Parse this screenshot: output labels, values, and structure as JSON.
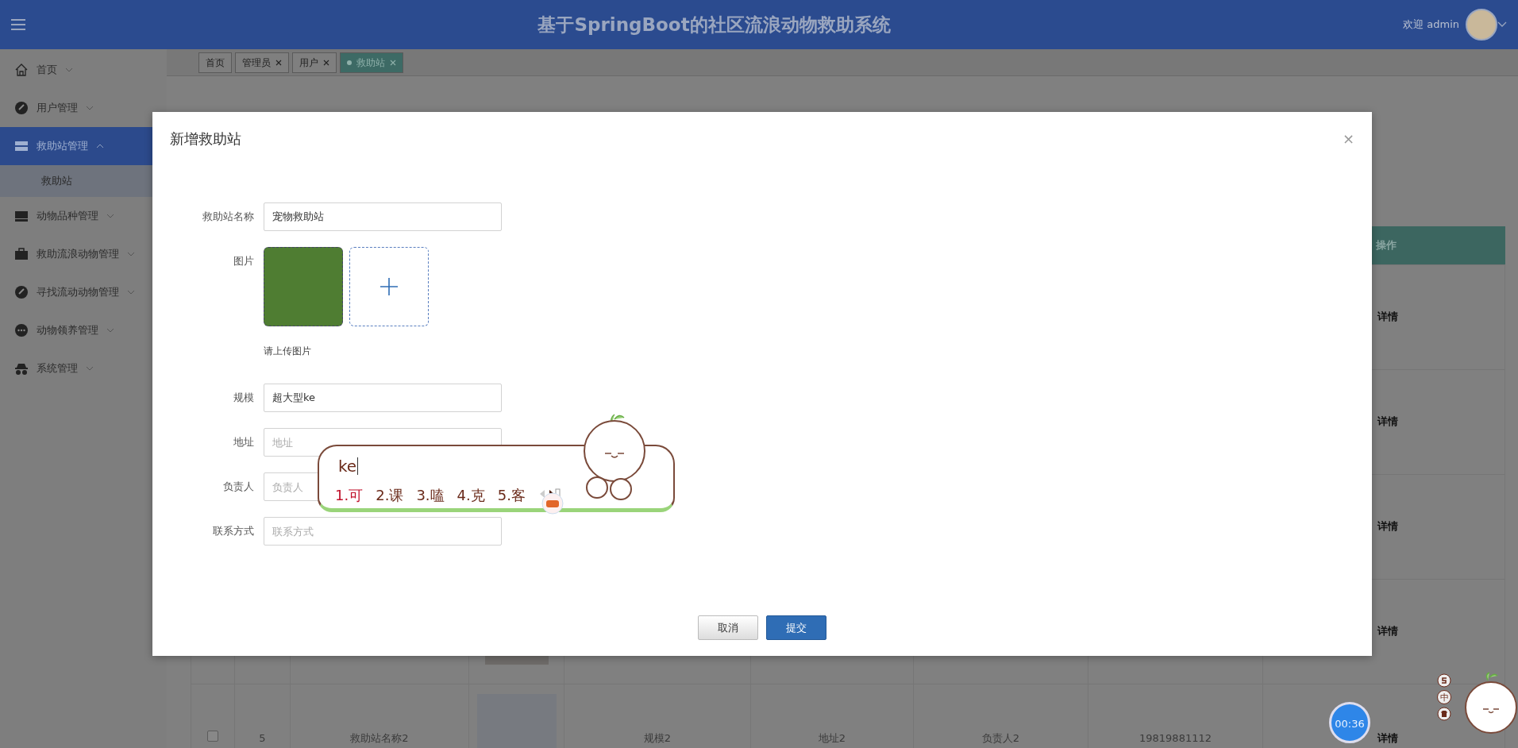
{
  "header": {
    "title": "基于SpringBoot的社区流浪动物救助系统",
    "welcome": "欢迎 admin"
  },
  "sidebar": {
    "items": [
      {
        "label": "首页",
        "selected": false,
        "expanded": false
      },
      {
        "label": "用户管理",
        "selected": false,
        "expanded": false
      },
      {
        "label": "救助站管理",
        "selected": true,
        "expanded": true,
        "children": [
          {
            "label": "救助站",
            "selected": true
          }
        ]
      },
      {
        "label": "动物品种管理",
        "selected": false,
        "expanded": false
      },
      {
        "label": "救助流浪动物管理",
        "selected": false,
        "expanded": false
      },
      {
        "label": "寻找流动动物管理",
        "selected": false,
        "expanded": false
      },
      {
        "label": "动物领养管理",
        "selected": false,
        "expanded": false
      },
      {
        "label": "系统管理",
        "selected": false,
        "expanded": false
      }
    ]
  },
  "tabs": [
    {
      "label": "首页",
      "selected": false,
      "closable": false
    },
    {
      "label": "管理员",
      "selected": false,
      "closable": true
    },
    {
      "label": "用户",
      "selected": false,
      "closable": true
    },
    {
      "label": "救助站",
      "selected": true,
      "closable": true
    }
  ],
  "table": {
    "action_heading": "操作",
    "rows": [
      {
        "action": "详情"
      },
      {
        "action": "详情"
      },
      {
        "action": "详情"
      },
      {
        "action": "详情"
      },
      {
        "checked": false,
        "index": "5",
        "name": "救助站名称2",
        "scale": "规模2",
        "address": "地址2",
        "manager": "负责人2",
        "phone": "19819881112",
        "action": "详情"
      }
    ]
  },
  "dialog": {
    "title": "新增救助站",
    "close": "×",
    "fields": [
      {
        "kind": "text",
        "label": "救助站名称",
        "value": "宠物救助站"
      },
      {
        "kind": "image",
        "label": "图片",
        "hint": "请上传图片"
      },
      {
        "kind": "text",
        "label": "规模",
        "value": "超大型ke"
      },
      {
        "kind": "text",
        "label": "地址",
        "placeholder": "地址"
      },
      {
        "kind": "text",
        "label": "负责人",
        "placeholder": "负责人"
      },
      {
        "kind": "text",
        "label": "联系方式",
        "placeholder": "联系方式"
      }
    ],
    "buttons": [
      {
        "label": "取消",
        "kind": "secondary"
      },
      {
        "label": "提交",
        "kind": "primary"
      }
    ]
  },
  "ime": {
    "composition": "ke",
    "candidates": [
      {
        "label": "1.可",
        "selected": true
      },
      {
        "label": "2.课",
        "selected": false
      },
      {
        "label": "3.嗑",
        "selected": false
      },
      {
        "label": "4.克",
        "selected": false
      },
      {
        "label": "5.客",
        "selected": false
      }
    ],
    "status_mode": "中"
  },
  "timer": "00:36"
}
